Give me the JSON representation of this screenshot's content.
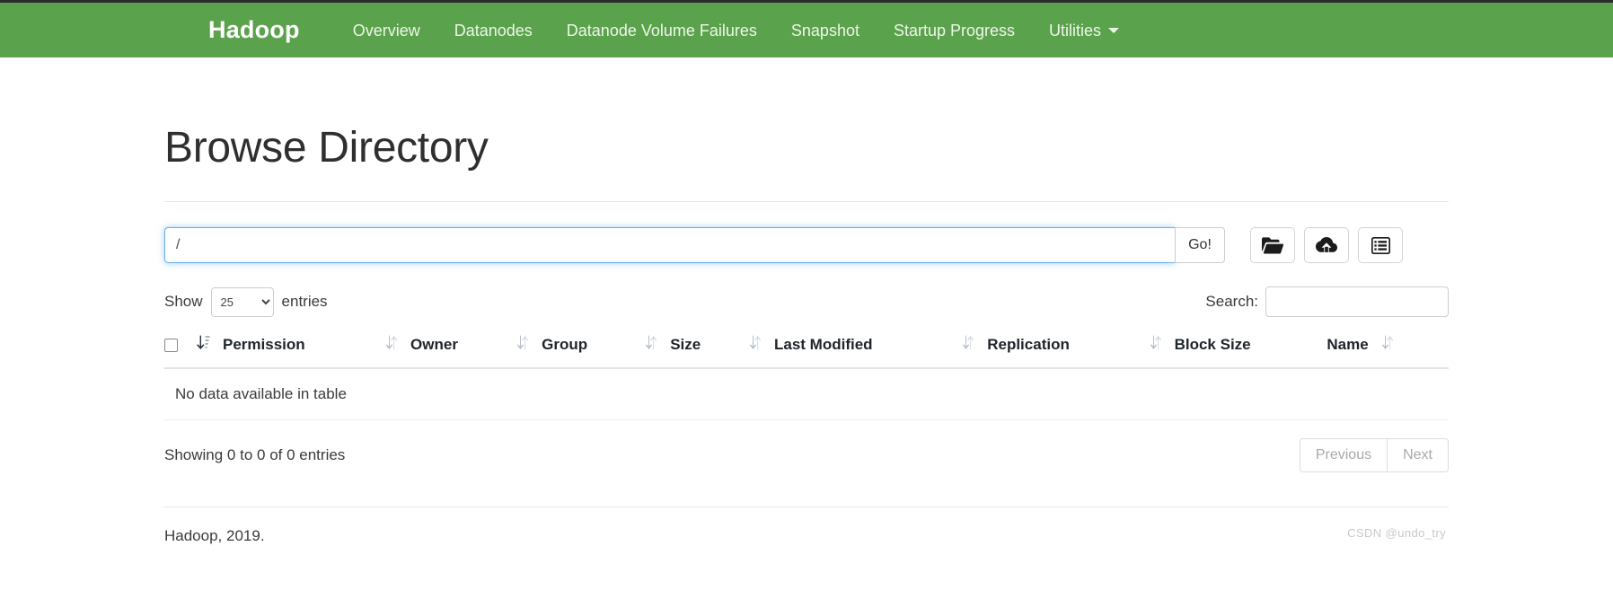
{
  "navbar": {
    "brand": "Hadoop",
    "brand_color": "#ffffff",
    "background_color": "#5ba24c",
    "links": [
      {
        "label": "Overview",
        "name": "nav-link-overview"
      },
      {
        "label": "Datanodes",
        "name": "nav-link-datanodes"
      },
      {
        "label": "Datanode Volume Failures",
        "name": "nav-link-datanode-volume-failures"
      },
      {
        "label": "Snapshot",
        "name": "nav-link-snapshot"
      },
      {
        "label": "Startup Progress",
        "name": "nav-link-startup-progress"
      }
    ],
    "dropdown": {
      "label": "Utilities",
      "caret_icon": "caret-down-icon"
    }
  },
  "page": {
    "title": "Browse Directory"
  },
  "pathbar": {
    "input_value": "/",
    "input_placeholder": "",
    "go_label": "Go!",
    "buttons": [
      {
        "name": "create-directory-button",
        "icon": "folder-open-icon",
        "title": "Create Directory"
      },
      {
        "name": "upload-files-button",
        "icon": "cloud-upload-icon",
        "title": "Upload Files"
      },
      {
        "name": "cut-paste-button",
        "icon": "list-alt-icon",
        "title": "Clipboard"
      }
    ]
  },
  "table_controls": {
    "show_label": "Show",
    "entries_label": "entries",
    "length_value": "25",
    "length_options": [
      "25"
    ],
    "search_label": "Search:",
    "search_value": "",
    "search_placeholder": ""
  },
  "table": {
    "select_all_name": "select-all-checkbox",
    "columns": [
      {
        "label": "Permission",
        "sort_icon": "sort-amount-down-icon"
      },
      {
        "label": "Owner",
        "sort_icon": "sort-updown-icon"
      },
      {
        "label": "Group",
        "sort_icon": "sort-updown-icon"
      },
      {
        "label": "Size",
        "sort_icon": "sort-updown-icon"
      },
      {
        "label": "Last Modified",
        "sort_icon": "sort-updown-icon"
      },
      {
        "label": "Replication",
        "sort_icon": "sort-updown-icon"
      },
      {
        "label": "Block Size",
        "sort_icon": "sort-updown-icon"
      },
      {
        "label": "Name",
        "sort_icon": "sort-updown-icon"
      }
    ],
    "rows": [],
    "empty_message": "No data available in table"
  },
  "table_footer": {
    "info": "Showing 0 to 0 of 0 entries",
    "previous_label": "Previous",
    "next_label": "Next"
  },
  "footer": {
    "text": "Hadoop, 2019."
  },
  "watermark": {
    "text": "CSDN @undo_try"
  }
}
